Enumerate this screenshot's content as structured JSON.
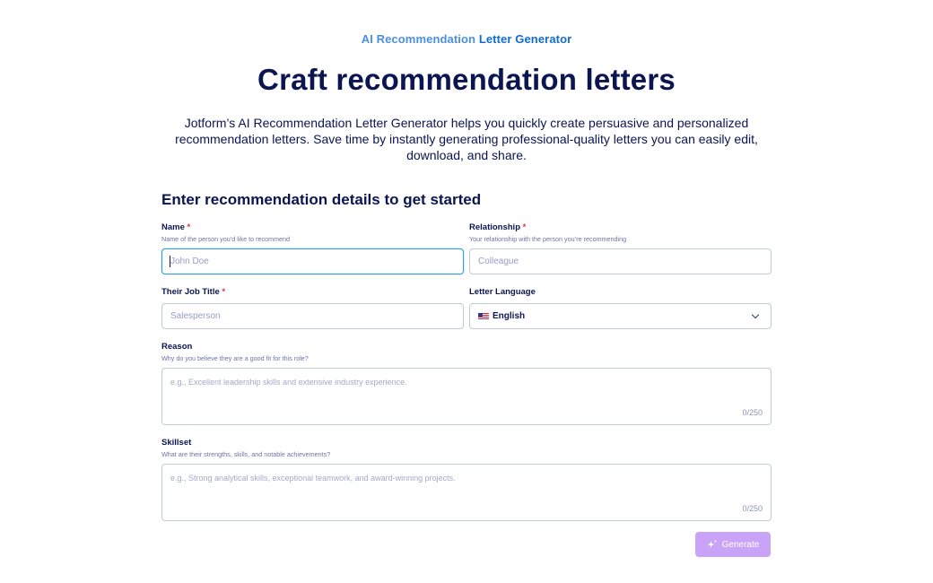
{
  "header": {
    "eyebrow_part1": "AI Recommendation",
    "eyebrow_part2": "Letter Generator",
    "title": "Craft recommendation letters",
    "description": "Jotform’s AI Recommendation Letter Generator helps you quickly create persuasive and personalized recommendation letters. Save time by instantly generating professional-quality letters you can easily edit, download, and share."
  },
  "form": {
    "section_title": "Enter recommendation details to get started",
    "name": {
      "label": "Name",
      "required_mark": "*",
      "hint": "Name of the person you’d like to recommend",
      "placeholder": "John Doe",
      "value": ""
    },
    "relationship": {
      "label": "Relationship",
      "required_mark": "*",
      "hint": "Your relationship with the person you’re recommending",
      "placeholder": "Colleague",
      "value": ""
    },
    "job_title": {
      "label": "Their Job Title",
      "required_mark": "*",
      "placeholder": "Salesperson",
      "value": ""
    },
    "language": {
      "label": "Letter Language",
      "selected": "English",
      "flag_icon": "us-flag-icon"
    },
    "reason": {
      "label": "Reason",
      "hint": "Why do you believe they are a good fit for this role?",
      "placeholder": "e.g., Excellent leadership skills and extensive industry experience.",
      "counter": "0/250"
    },
    "skillset": {
      "label": "Skillset",
      "hint": "What are their strengths, skills, and notable achievements?",
      "placeholder": "e.g., Strong analytical skills, exceptional teamwork, and award-winning projects.",
      "counter": "0/250"
    },
    "generate_label": "Generate",
    "generate_icon": "sparkle-icon"
  },
  "colors": {
    "text_primary": "#0a1551",
    "eyebrow_light": "#4a90e2",
    "eyebrow_dark": "#0f6bd7",
    "required": "#e5314b",
    "focus_border": "#2d9ed6",
    "generate_button": "#c9a3f7"
  }
}
